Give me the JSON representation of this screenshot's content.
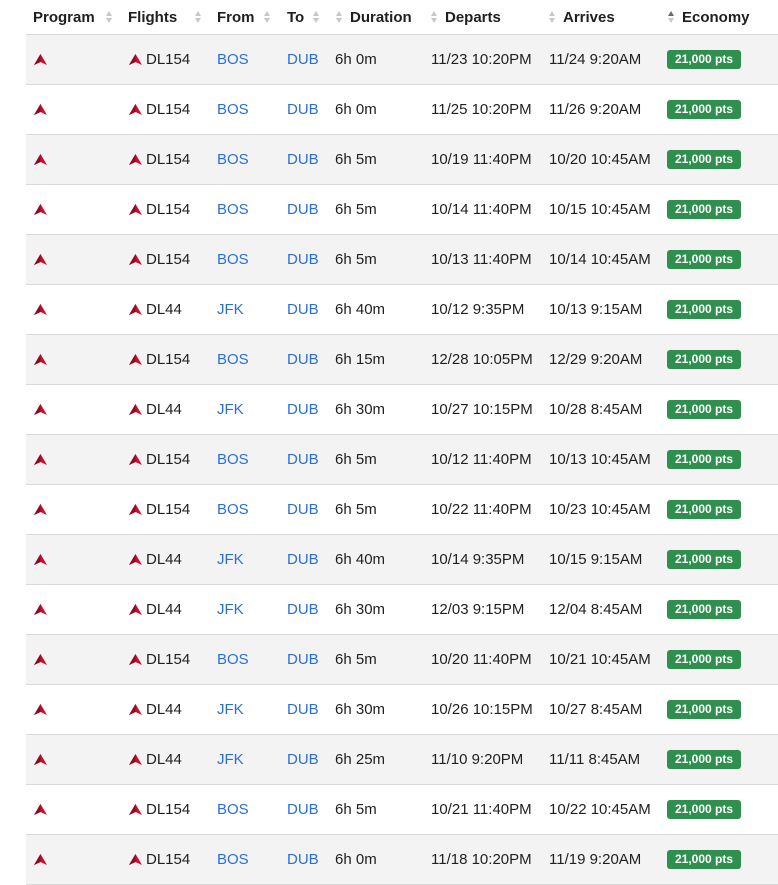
{
  "header": {
    "program": "Program",
    "flights": "Flights",
    "from": "From",
    "to": "To",
    "duration": "Duration",
    "departs": "Departs",
    "arrives": "Arrives",
    "economy": "Economy"
  },
  "icons": {
    "airline": "delta-logo-icon",
    "sort": "sort-icon"
  },
  "colors": {
    "link": "#2b6fd6",
    "badge": "#2f8f4e",
    "delta_red": "#c8102e"
  },
  "rows": [
    {
      "flight": "DL154",
      "from": "BOS",
      "to": "DUB",
      "duration": "6h 0m",
      "departs": "11/23 10:20PM",
      "arrives": "11/24 9:20AM",
      "economy": "21,000 pts"
    },
    {
      "flight": "DL154",
      "from": "BOS",
      "to": "DUB",
      "duration": "6h 0m",
      "departs": "11/25 10:20PM",
      "arrives": "11/26 9:20AM",
      "economy": "21,000 pts"
    },
    {
      "flight": "DL154",
      "from": "BOS",
      "to": "DUB",
      "duration": "6h 5m",
      "departs": "10/19 11:40PM",
      "arrives": "10/20 10:45AM",
      "economy": "21,000 pts"
    },
    {
      "flight": "DL154",
      "from": "BOS",
      "to": "DUB",
      "duration": "6h 5m",
      "departs": "10/14 11:40PM",
      "arrives": "10/15 10:45AM",
      "economy": "21,000 pts"
    },
    {
      "flight": "DL154",
      "from": "BOS",
      "to": "DUB",
      "duration": "6h 5m",
      "departs": "10/13 11:40PM",
      "arrives": "10/14 10:45AM",
      "economy": "21,000 pts"
    },
    {
      "flight": "DL44",
      "from": "JFK",
      "to": "DUB",
      "duration": "6h 40m",
      "departs": "10/12 9:35PM",
      "arrives": "10/13 9:15AM",
      "economy": "21,000 pts"
    },
    {
      "flight": "DL154",
      "from": "BOS",
      "to": "DUB",
      "duration": "6h 15m",
      "departs": "12/28 10:05PM",
      "arrives": "12/29 9:20AM",
      "economy": "21,000 pts"
    },
    {
      "flight": "DL44",
      "from": "JFK",
      "to": "DUB",
      "duration": "6h 30m",
      "departs": "10/27 10:15PM",
      "arrives": "10/28 8:45AM",
      "economy": "21,000 pts"
    },
    {
      "flight": "DL154",
      "from": "BOS",
      "to": "DUB",
      "duration": "6h 5m",
      "departs": "10/12 11:40PM",
      "arrives": "10/13 10:45AM",
      "economy": "21,000 pts"
    },
    {
      "flight": "DL154",
      "from": "BOS",
      "to": "DUB",
      "duration": "6h 5m",
      "departs": "10/22 11:40PM",
      "arrives": "10/23 10:45AM",
      "economy": "21,000 pts"
    },
    {
      "flight": "DL44",
      "from": "JFK",
      "to": "DUB",
      "duration": "6h 40m",
      "departs": "10/14 9:35PM",
      "arrives": "10/15 9:15AM",
      "economy": "21,000 pts"
    },
    {
      "flight": "DL44",
      "from": "JFK",
      "to": "DUB",
      "duration": "6h 30m",
      "departs": "12/03 9:15PM",
      "arrives": "12/04 8:45AM",
      "economy": "21,000 pts"
    },
    {
      "flight": "DL154",
      "from": "BOS",
      "to": "DUB",
      "duration": "6h 5m",
      "departs": "10/20 11:40PM",
      "arrives": "10/21 10:45AM",
      "economy": "21,000 pts"
    },
    {
      "flight": "DL44",
      "from": "JFK",
      "to": "DUB",
      "duration": "6h 30m",
      "departs": "10/26 10:15PM",
      "arrives": "10/27 8:45AM",
      "economy": "21,000 pts"
    },
    {
      "flight": "DL44",
      "from": "JFK",
      "to": "DUB",
      "duration": "6h 25m",
      "departs": "11/10 9:20PM",
      "arrives": "11/11 8:45AM",
      "economy": "21,000 pts"
    },
    {
      "flight": "DL154",
      "from": "BOS",
      "to": "DUB",
      "duration": "6h 5m",
      "departs": "10/21 11:40PM",
      "arrives": "10/22 10:45AM",
      "economy": "21,000 pts"
    },
    {
      "flight": "DL154",
      "from": "BOS",
      "to": "DUB",
      "duration": "6h 0m",
      "departs": "11/18 10:20PM",
      "arrives": "11/19 9:20AM",
      "economy": "21,000 pts"
    }
  ]
}
